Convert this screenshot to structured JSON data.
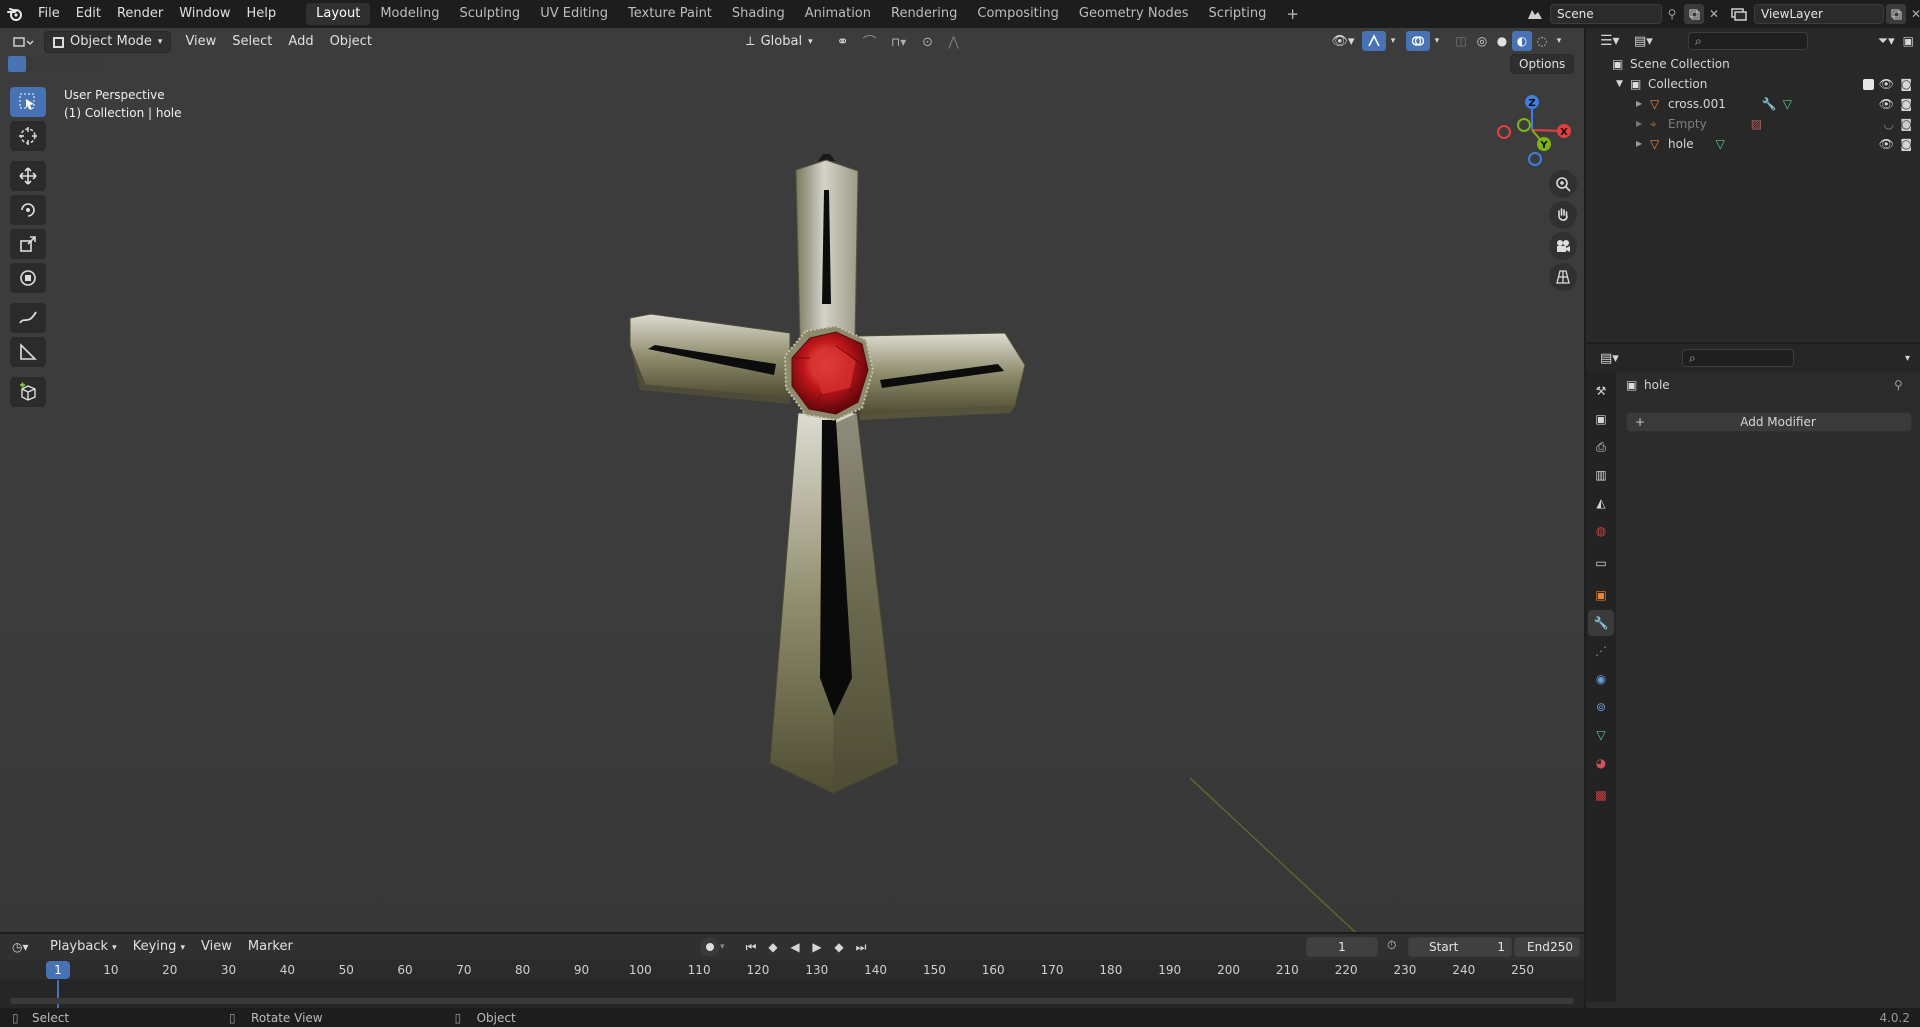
{
  "topbar": {
    "menus": [
      "File",
      "Edit",
      "Render",
      "Window",
      "Help"
    ],
    "workspaces": [
      "Layout",
      "Modeling",
      "Sculpting",
      "UV Editing",
      "Texture Paint",
      "Shading",
      "Animation",
      "Rendering",
      "Compositing",
      "Geometry Nodes",
      "Scripting"
    ],
    "active_workspace": "Layout",
    "scene": "Scene",
    "view_layer": "ViewLayer"
  },
  "viewport": {
    "mode": "Object Mode",
    "menus": [
      "View",
      "Select",
      "Add",
      "Object"
    ],
    "orientation": "Global",
    "options_label": "Options",
    "overlay_title": "User Perspective",
    "overlay_subtitle": "(1) Collection | hole",
    "gizmo_axes": {
      "x": "X",
      "y": "Y",
      "z": "Z"
    }
  },
  "outliner": {
    "root": "Scene Collection",
    "collection": "Collection",
    "items": [
      {
        "name": "cross.001",
        "dimmed": false
      },
      {
        "name": "Empty",
        "dimmed": true
      },
      {
        "name": "hole",
        "dimmed": false
      }
    ]
  },
  "properties": {
    "object_name": "hole",
    "add_modifier": "Add Modifier"
  },
  "timeline": {
    "menus": [
      "Playback",
      "Keying",
      "View",
      "Marker"
    ],
    "current_frame": "1",
    "start_label": "Start",
    "start_value": "1",
    "end_label": "End",
    "end_value": "250",
    "ruler_ticks": [
      "1",
      "10",
      "20",
      "30",
      "40",
      "50",
      "60",
      "70",
      "80",
      "90",
      "100",
      "110",
      "120",
      "130",
      "140",
      "150",
      "160",
      "170",
      "180",
      "190",
      "200",
      "210",
      "220",
      "230",
      "240",
      "250"
    ],
    "playhead": "1"
  },
  "statusbar": {
    "select": "Select",
    "rotate": "Rotate View",
    "object": "Object",
    "version": "4.0.2"
  },
  "colors": {
    "accent": "#4772b3",
    "viewport_bg": "#3c3c3c",
    "gem_red": "#c0161a",
    "x_axis": "#e2403f",
    "y_axis": "#7fb418",
    "z_axis": "#3f7ee0"
  }
}
